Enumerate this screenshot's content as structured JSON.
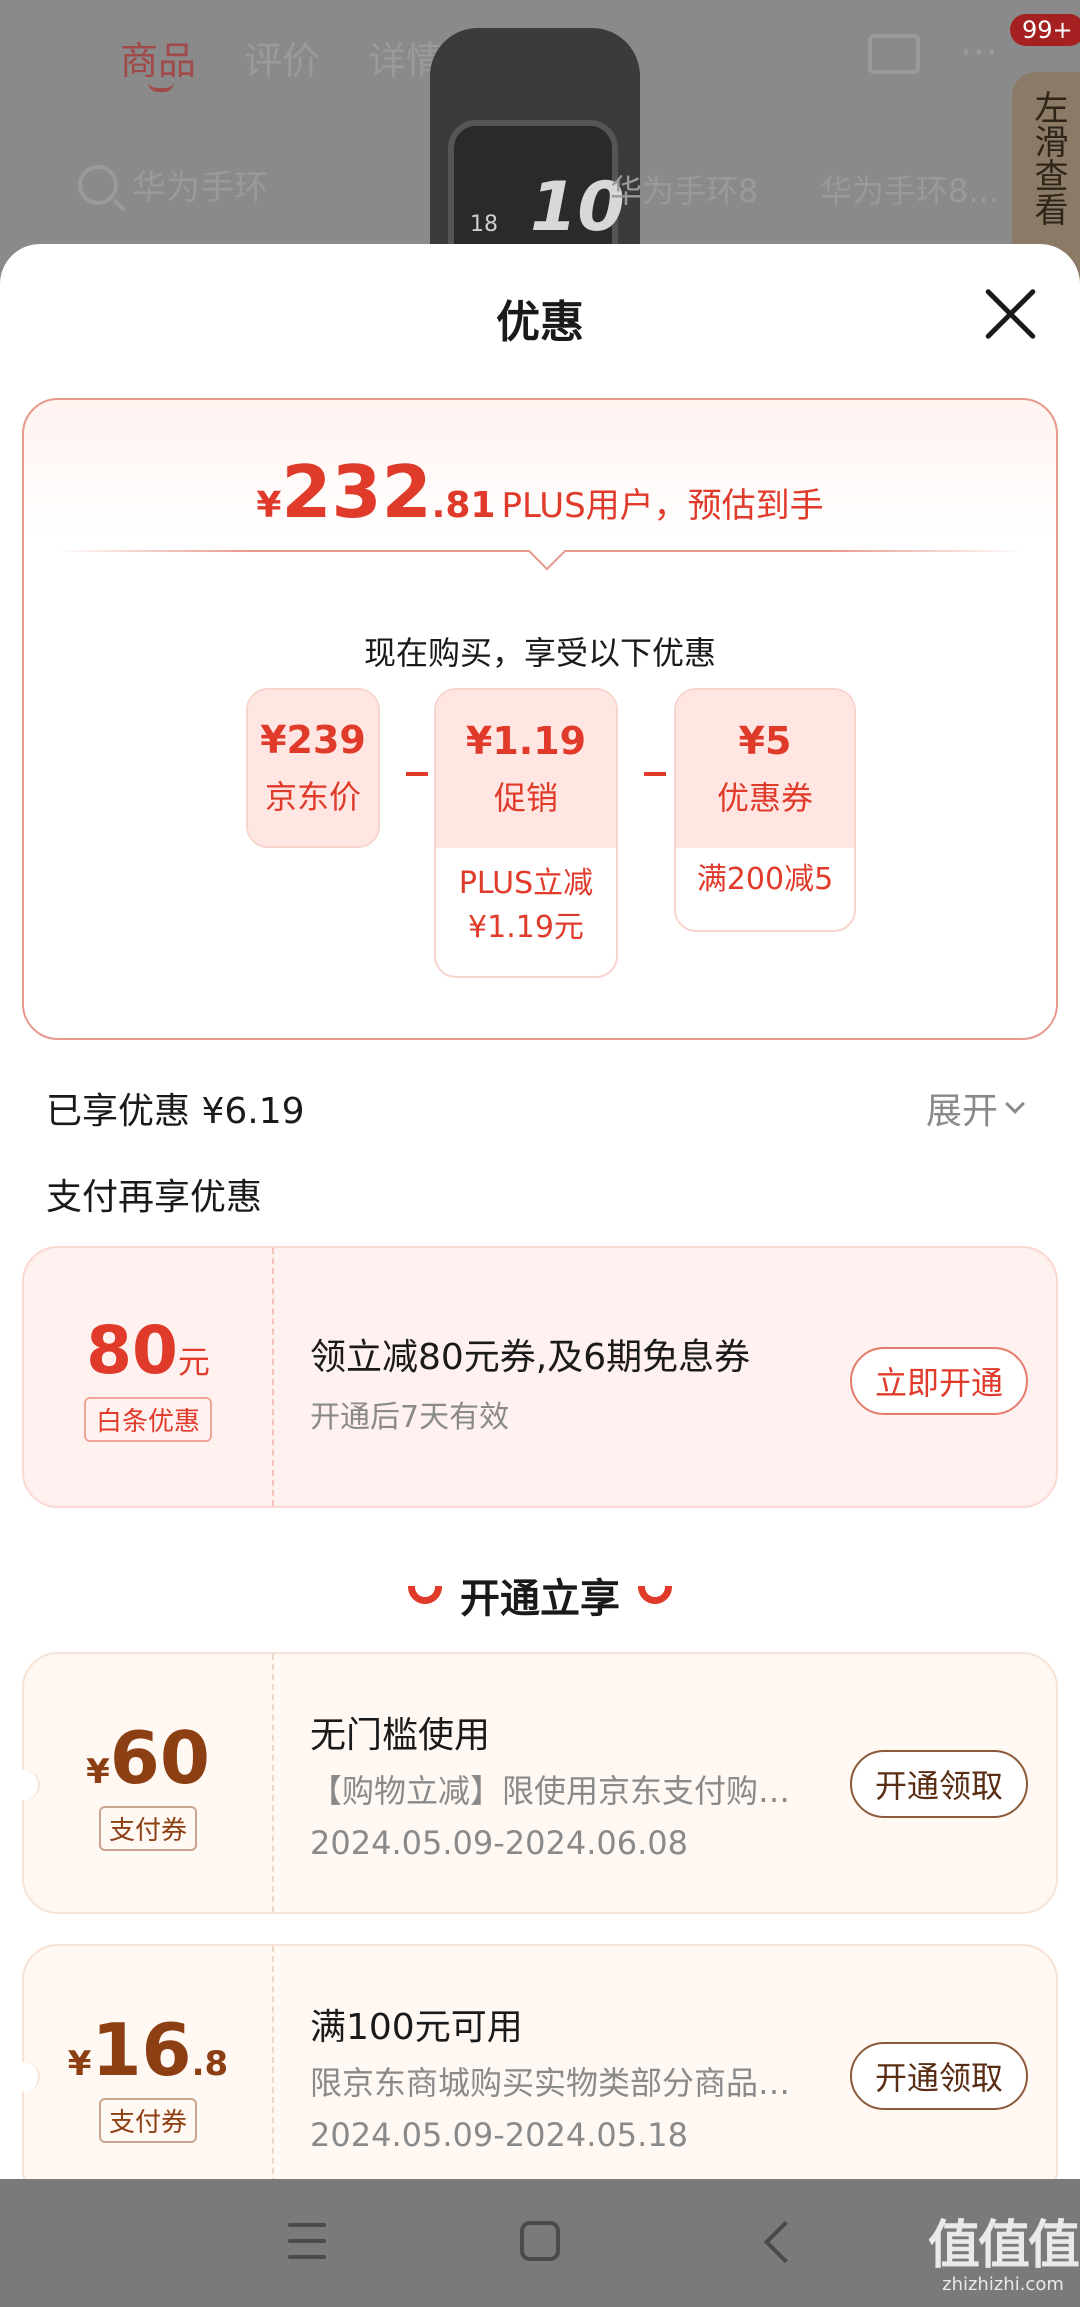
{
  "background": {
    "tabs": [
      "商品",
      "评价",
      "详情"
    ],
    "badge": "99+",
    "search_text": "华为手环",
    "chips": [
      "华为手环8",
      "华为手环8..."
    ],
    "side_tab": "左滑查看",
    "watch_number": "10",
    "watch_date": "18"
  },
  "sheet": {
    "title": "优惠"
  },
  "price_card": {
    "yen": "¥",
    "price_int": "232",
    "price_dec": ".81",
    "price_desc": "PLUS用户，预估到手",
    "subtitle": "现在购买，享受以下优惠",
    "items": [
      {
        "value": "¥239",
        "label": "京东价",
        "note": ""
      },
      {
        "value": "¥1.19",
        "label": "促销",
        "note_lines": [
          "PLUS立减",
          "¥1.19元"
        ]
      },
      {
        "value": "¥5",
        "label": "优惠券",
        "note_lines": [
          "满200减5"
        ]
      }
    ]
  },
  "saved": {
    "label": "已享优惠 ¥6.19",
    "expand": "展开"
  },
  "pay_more": {
    "heading": "支付再享优惠",
    "amount": "80",
    "unit": "元",
    "tag": "白条优惠",
    "title": "领立减80元券,及6期免息券",
    "subtitle": "开通后7天有效",
    "button": "立即开通"
  },
  "open_section": {
    "heading": "开通立享",
    "coupons": [
      {
        "yen": "¥",
        "amount": "60",
        "dec": "",
        "tag": "支付券",
        "title": "无门槛使用",
        "desc": "【购物立减】限使用京东支付购买部分商品",
        "date": "2024.05.09-2024.06.08",
        "button": "开通领取"
      },
      {
        "yen": "¥",
        "amount": "16",
        "dec": ".8",
        "tag": "支付券",
        "title": "满100元可用",
        "desc": "限京东商城购买实物类部分商品使用",
        "date": "2024.05.09-2024.05.18",
        "button": "开通领取"
      }
    ]
  },
  "watermark": {
    "big": "值值值",
    "small": "zhizhizhi.com"
  },
  "colors": {
    "accent_red": "#e03a2a",
    "coupon_brown": "#8c3f12",
    "card_pink": "#fff1ef"
  }
}
